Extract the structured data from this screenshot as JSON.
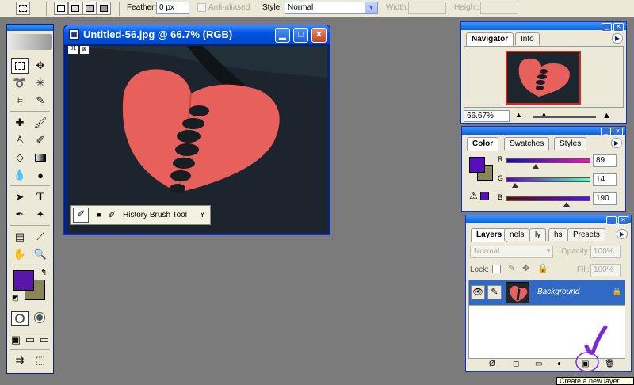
{
  "options_bar": {
    "feather_label": "Feather:",
    "feather_value": "0 px",
    "anti_aliased_label": "Anti-aliased",
    "style_label": "Style:",
    "style_value": "Normal",
    "width_label": "Width:",
    "height_label": "Height:"
  },
  "document": {
    "title": "Untitled-56.jpg @ 66.7% (RGB)",
    "title_bar_buttons": [
      "minimize",
      "maximize",
      "close"
    ]
  },
  "tooltip": {
    "tool_name": "History Brush Tool",
    "shortcut": "Y",
    "current_marker": "■"
  },
  "toolbox": {
    "icons": [
      "marquee-icon",
      "move-icon",
      "lasso-icon",
      "magic-wand-icon",
      "crop-icon",
      "slice-icon",
      "healing-brush-icon",
      "brush-icon",
      "clone-stamp-icon",
      "history-brush-icon",
      "eraser-icon",
      "gradient-icon",
      "blur-icon",
      "dodge-icon",
      "path-selection-icon",
      "type-icon",
      "pen-icon",
      "custom-shape-icon",
      "notes-icon",
      "eyedropper-icon",
      "hand-icon",
      "zoom-icon"
    ],
    "foreground_color": "#5a16a8",
    "background_color": "#8a8658"
  },
  "navigator": {
    "tabs": [
      "Navigator",
      "Info"
    ],
    "zoom": "66.67%"
  },
  "color_panel": {
    "tabs": [
      "Color",
      "Swatches",
      "Styles"
    ],
    "r_label": "R",
    "r_value": "89",
    "g_label": "G",
    "g_value": "14",
    "b_label": "B",
    "b_value": "190",
    "current_color": "#590ebe",
    "background_color": "#8a8658"
  },
  "layers_panel": {
    "tabs": [
      "Layers",
      "nels",
      "ly",
      "hs",
      "Presets"
    ],
    "blend_mode": "Normal",
    "opacity_label": "Opacity:",
    "opacity_value": "100%",
    "lock_label": "Lock:",
    "fill_label": "Fill:",
    "fill_value": "100%",
    "layer_name": "Background",
    "bottom_tooltip": "Create a new layer"
  },
  "colors": {
    "canvas_bg": "#7b7b7b",
    "panel_bg": "#ece9d8",
    "xp_blue": "#0054e3",
    "layer_selected": "#316ac5",
    "annotation": "#7a2cd6"
  }
}
